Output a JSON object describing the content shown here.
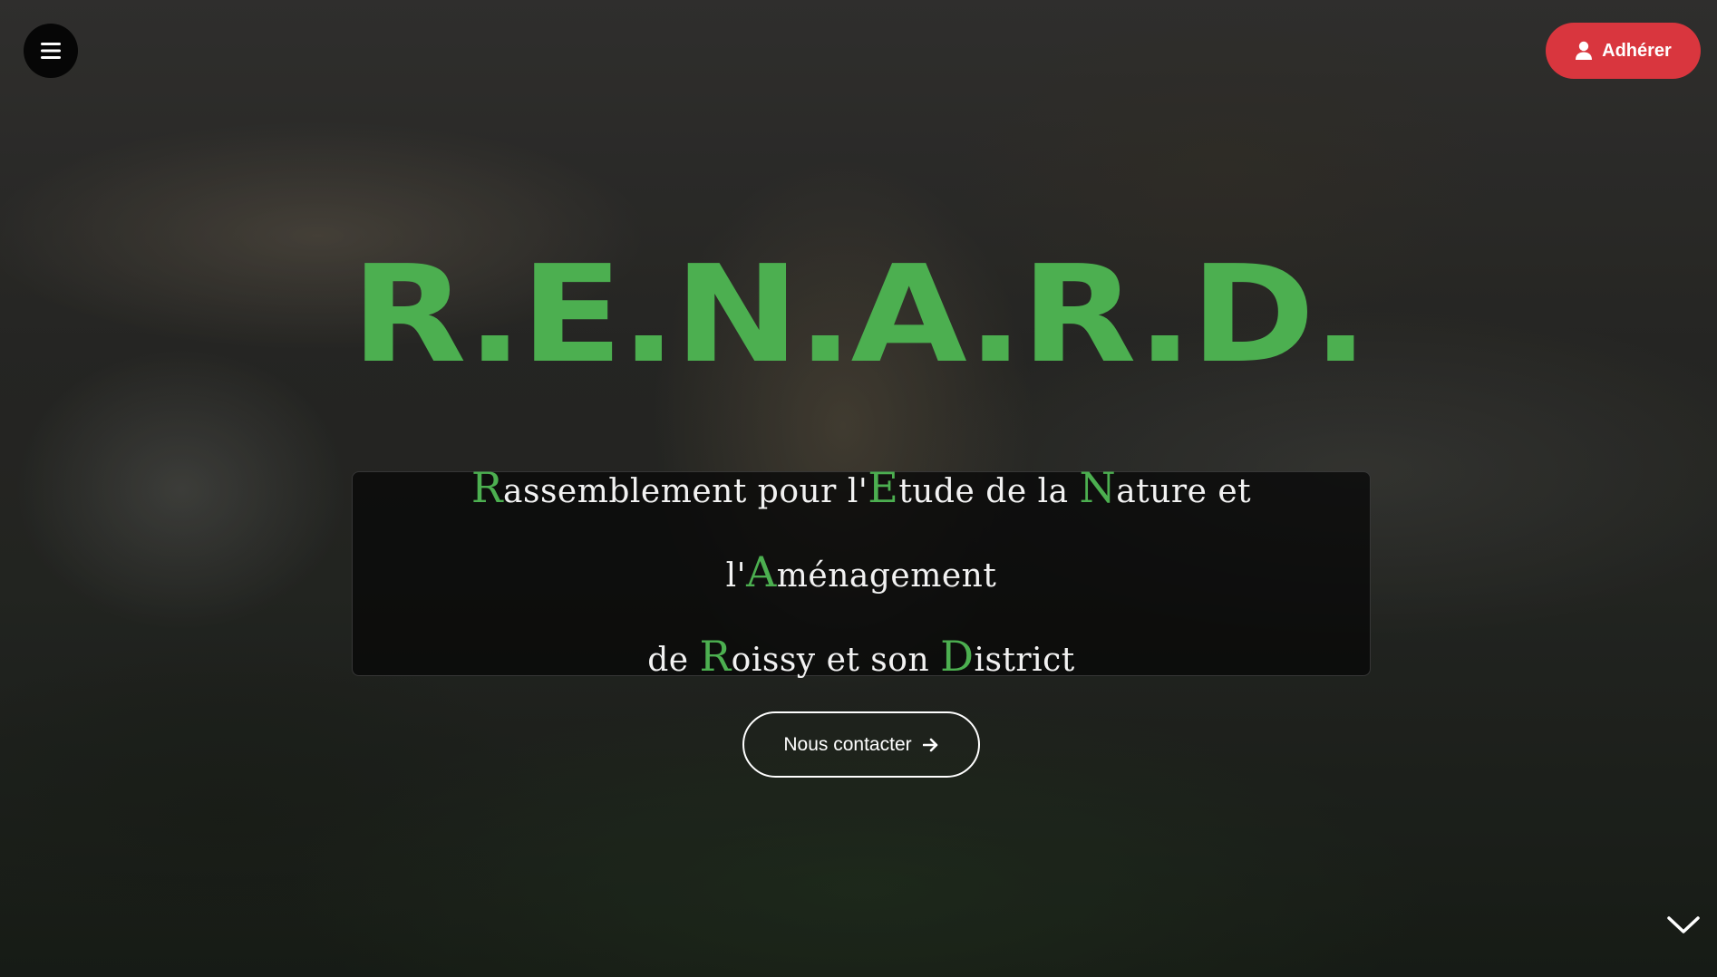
{
  "header": {
    "menu_icon": "hamburger-menu-icon",
    "join_label": "Adhérer",
    "join_icon": "user-icon"
  },
  "hero": {
    "title": "R.E.N.A.R.D.",
    "subtitle": {
      "segments": [
        {
          "initial": "R",
          "rest": "assemblement pour l'"
        },
        {
          "initial": "E",
          "rest": "tude de la "
        },
        {
          "initial": "N",
          "rest": "ature et l'"
        },
        {
          "initial": "A",
          "rest": "ménagement"
        },
        {
          "prefix": "de ",
          "initial": "R",
          "rest": "oissy et son "
        },
        {
          "initial": "D",
          "rest": "istrict"
        }
      ]
    },
    "contact_label": "Nous contacter",
    "contact_icon": "arrow-right-icon",
    "scroll_icon": "chevron-down-icon"
  },
  "colors": {
    "accent_green": "#4caf50",
    "join_red": "#d9363e",
    "box_background": "#080808"
  }
}
